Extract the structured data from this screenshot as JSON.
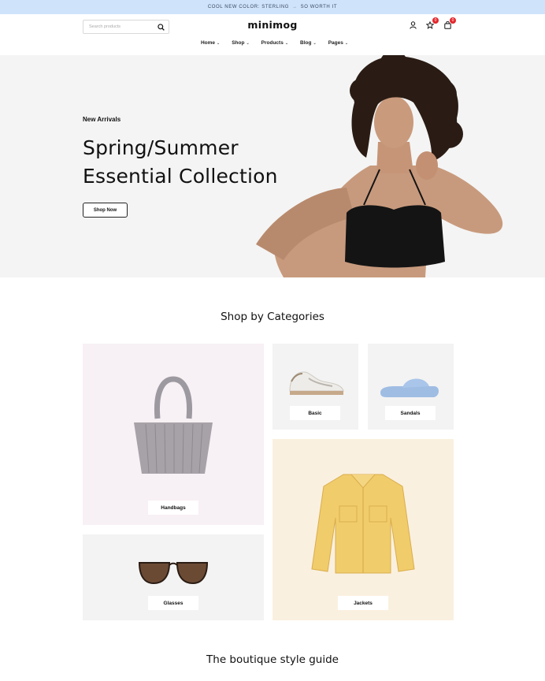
{
  "announcement": {
    "text_left": "COOL NEW COLOR: STERLING",
    "arrow": "→",
    "text_right": "SO WORTH IT"
  },
  "header": {
    "search_placeholder": "Search products",
    "logo": "minimog",
    "wishlist_count": "0",
    "cart_count": "0",
    "nav": [
      {
        "label": "Home"
      },
      {
        "label": "Shop"
      },
      {
        "label": "Products"
      },
      {
        "label": "Blog"
      },
      {
        "label": "Pages"
      }
    ]
  },
  "hero": {
    "subtitle": "New Arrivals",
    "title_line1": "Spring/Summer",
    "title_line2": "Essential Collection",
    "button": "Shop Now"
  },
  "categories": {
    "title": "Shop by Categories",
    "items": [
      {
        "label": "Handbags",
        "bg": "#f7f0f4"
      },
      {
        "label": "Basic",
        "bg": "#f3f3f3"
      },
      {
        "label": "Sandals",
        "bg": "#f3f3f3"
      },
      {
        "label": "Jackets",
        "bg": "#faf0e0"
      },
      {
        "label": "Glasses",
        "bg": "#f3f3f3"
      }
    ]
  },
  "guide": {
    "title": "The boutique style guide"
  },
  "colors": {
    "announcement_bg": "#cfe3fb",
    "badge": "#e3262c",
    "hero_bg": "#f4f4f4"
  }
}
